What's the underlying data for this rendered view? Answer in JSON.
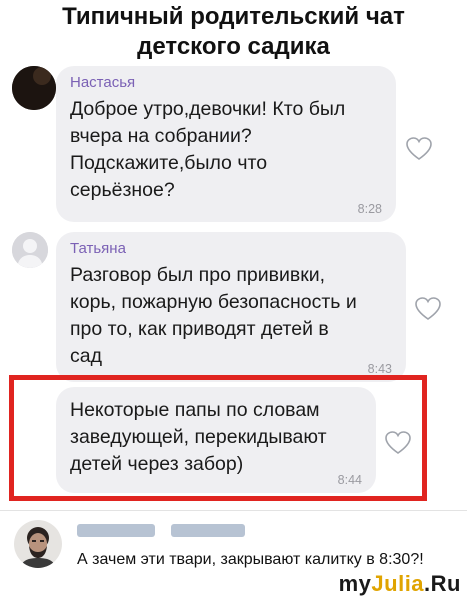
{
  "header": {
    "title_line1": "Типичный родительский чат",
    "title_line2": "детского садика"
  },
  "messages": [
    {
      "sender": "Настасья",
      "text_lines": [
        "Доброе утро,девочки! Кто был",
        "вчера на собрании?",
        "Подскажите,было что",
        "серьёзное?"
      ],
      "time": "8:28",
      "avatar": "dark-avatar",
      "icon": "heart-icon"
    },
    {
      "sender": "Татьяна",
      "text_lines": [
        "Разговор был про прививки,",
        "корь, пожарную безопасность и",
        "про то, как приводят детей в",
        "сад"
      ],
      "time": "8:43",
      "avatar": "default-user-avatar",
      "icon": "heart-icon"
    },
    {
      "sender": "",
      "text_lines": [
        "Некоторые папы по словам",
        "заведующей, перекидывают",
        "детей через забор)"
      ],
      "time": "8:44",
      "icon": "heart-icon"
    }
  ],
  "comment": {
    "text": "А зачем эти твари, закрывают калитку в 8:30?!",
    "avatar": "man-photo-avatar"
  },
  "watermark": {
    "part1": "my",
    "part2": "Julia",
    "part3": ".Ru"
  },
  "colors": {
    "bubble": "#efeff2",
    "sender_name": "#7b61b5",
    "highlight_border": "#e02420"
  }
}
